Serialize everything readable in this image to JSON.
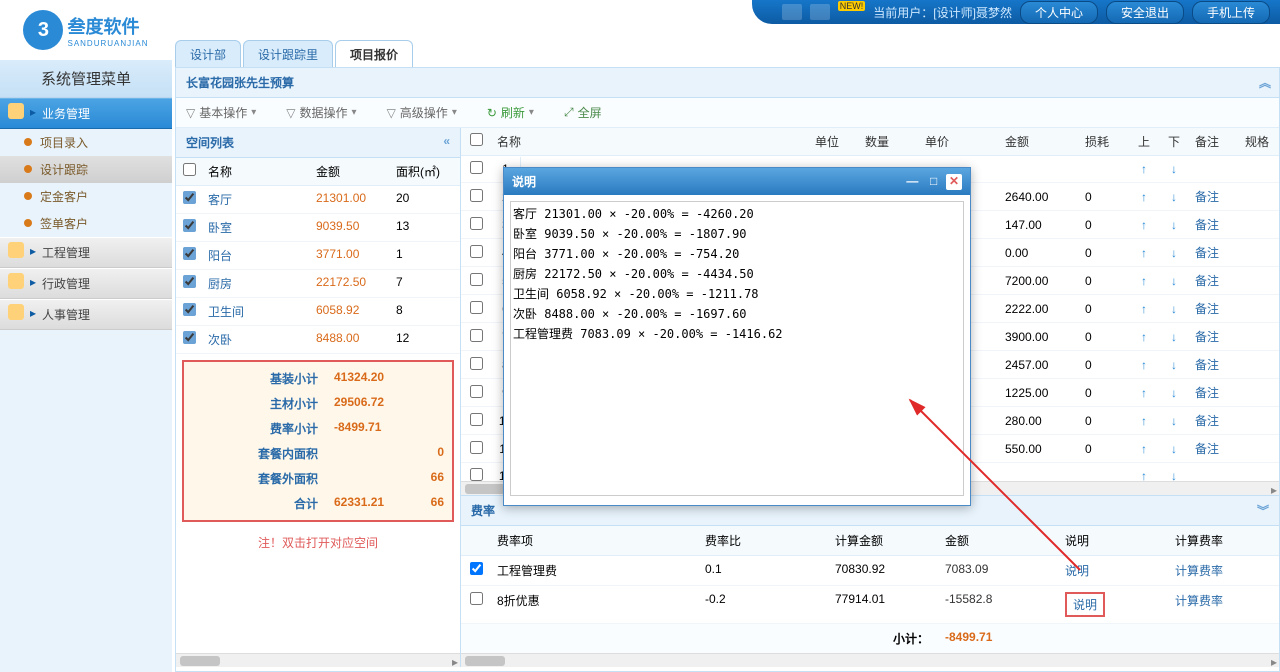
{
  "brand": {
    "name": "叁度软件",
    "sub": "SANDURUANJIAN",
    "glyph": "3"
  },
  "header": {
    "new_badge": "NEW!",
    "user_prefix": "当前用户：",
    "user_name": "[设计师]聂梦然",
    "btn_profile": "个人中心",
    "btn_logout": "安全退出",
    "btn_upload": "手机上传"
  },
  "sidebar": {
    "title": "系统管理菜单",
    "groups": [
      {
        "label": "业务管理",
        "style": "blue",
        "items": [
          {
            "label": "项目录入",
            "active": false
          },
          {
            "label": "设计跟踪",
            "active": true
          },
          {
            "label": "定金客户",
            "active": false
          },
          {
            "label": "签单客户",
            "active": false
          }
        ]
      },
      {
        "label": "工程管理",
        "style": "gray",
        "items": []
      },
      {
        "label": "行政管理",
        "style": "gray",
        "items": []
      },
      {
        "label": "人事管理",
        "style": "gray",
        "items": []
      }
    ]
  },
  "tabs": [
    {
      "label": "设计部",
      "active": false
    },
    {
      "label": "设计跟踪里",
      "active": false
    },
    {
      "label": "项目报价",
      "active": true
    }
  ],
  "breadcrumb": "长富花园张先生预算",
  "toolbar": {
    "basic": "基本操作",
    "data": "数据操作",
    "adv": "高级操作",
    "refresh": "刷新",
    "fullscreen": "全屏"
  },
  "space_panel": {
    "title": "空间列表",
    "cols": {
      "name": "名称",
      "amount": "金额",
      "area": "面积(㎡)"
    },
    "rows": [
      {
        "name": "客厅",
        "amount": "21301.00",
        "area": "20"
      },
      {
        "name": "卧室",
        "amount": "9039.50",
        "area": "13"
      },
      {
        "name": "阳台",
        "amount": "3771.00",
        "area": "1"
      },
      {
        "name": "厨房",
        "amount": "22172.50",
        "area": "7"
      },
      {
        "name": "卫生间",
        "amount": "6058.92",
        "area": "8"
      },
      {
        "name": "次卧",
        "amount": "8488.00",
        "area": "12"
      }
    ],
    "summary": [
      {
        "label": "基装小计",
        "v1": "41324.20",
        "v2": ""
      },
      {
        "label": "主材小计",
        "v1": "29506.72",
        "v2": ""
      },
      {
        "label": "费率小计",
        "v1": "-8499.71",
        "v2": ""
      },
      {
        "label": "套餐内面积",
        "v1": "",
        "v2": "0"
      },
      {
        "label": "套餐外面积",
        "v1": "",
        "v2": "66"
      },
      {
        "label": "合计",
        "v1": "62331.21",
        "v2": "66"
      }
    ],
    "hint": "注！双击打开对应空间"
  },
  "item_grid": {
    "cols": {
      "name": "名称",
      "unit": "单位",
      "qty": "数量",
      "price": "单价",
      "total": "金额",
      "loss": "损耗",
      "up": "上",
      "down": "下",
      "note": "备注",
      "spec": "规格"
    },
    "rows": [
      {
        "idx": "1",
        "total": "",
        "loss": "",
        "note": ""
      },
      {
        "idx": "2",
        "total": "2640.00",
        "loss": "0",
        "note": "备注"
      },
      {
        "idx": "3",
        "total": "147.00",
        "loss": "0",
        "note": "备注"
      },
      {
        "idx": "4",
        "total": "0.00",
        "loss": "0",
        "note": "备注"
      },
      {
        "idx": "5",
        "total": "7200.00",
        "loss": "0",
        "note": "备注"
      },
      {
        "idx": "6",
        "total": "2222.00",
        "loss": "0",
        "note": "备注"
      },
      {
        "idx": "7",
        "total": "3900.00",
        "loss": "0",
        "note": "备注"
      },
      {
        "idx": "8",
        "total": "2457.00",
        "loss": "0",
        "note": "备注"
      },
      {
        "idx": "9",
        "total": "1225.00",
        "loss": "0",
        "note": "备注"
      },
      {
        "idx": "10",
        "total": "280.00",
        "loss": "0",
        "note": "备注"
      },
      {
        "idx": "11",
        "total": "550.00",
        "loss": "0",
        "note": "备注"
      },
      {
        "idx": "12",
        "total": "",
        "loss": "",
        "note": ""
      }
    ]
  },
  "fee_panel": {
    "title": "费率",
    "cols": {
      "name": "费率项",
      "rate": "费率比",
      "base": "计算金额",
      "amount": "金额",
      "desc": "说明",
      "calc": "计算费率"
    },
    "rows": [
      {
        "name": "工程管理费",
        "rate": "0.1",
        "base": "70830.92",
        "amount": "7083.09",
        "desc": "说明",
        "calc": "计算费率",
        "chk": true,
        "hi": false
      },
      {
        "name": "8折优惠",
        "rate": "-0.2",
        "base": "77914.01",
        "amount": "-15582.8",
        "desc": "说明",
        "calc": "计算费率",
        "chk": false,
        "hi": true
      }
    ],
    "subtotal_label": "小计：",
    "subtotal_value": "-8499.71"
  },
  "dialog": {
    "title": "说明",
    "content": "客厅 21301.00 × -20.00% = -4260.20\n卧室 9039.50 × -20.00% = -1807.90\n阳台 3771.00 × -20.00% = -754.20\n厨房 22172.50 × -20.00% = -4434.50\n卫生间 6058.92 × -20.00% = -1211.78\n次卧 8488.00 × -20.00% = -1697.60\n工程管理费 7083.09 × -20.00% = -1416.62"
  }
}
